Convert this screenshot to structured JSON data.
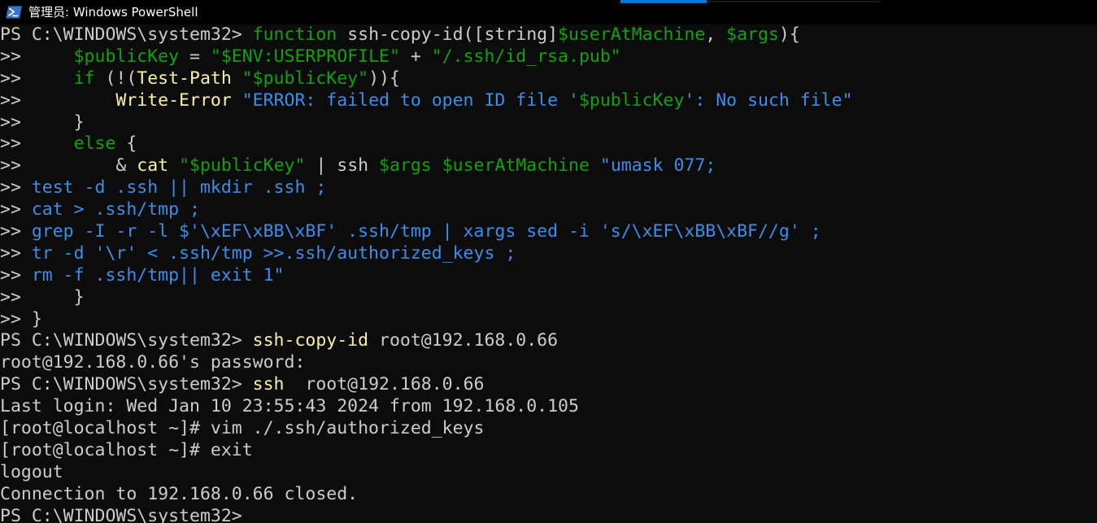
{
  "window": {
    "title": "管理员: Windows PowerShell",
    "icon": "powershell-icon",
    "accent_color": "#0078d7",
    "background_color": "#0c0c0c"
  },
  "palette": {
    "default_text": "#cccccc",
    "keyword_green": "#13a10e",
    "cmdlet_yellow": "#f9f1a5",
    "string_blue": "#3b8eea"
  },
  "terminal": {
    "prompt": "PS C:\\WINDOWS\\system32>",
    "continuation_prompt": ">>",
    "lines": [
      {
        "id": "line-01",
        "segments": [
          {
            "t": "PS C:\\WINDOWS\\system32> ",
            "c": "w"
          },
          {
            "t": "function",
            "c": "g"
          },
          {
            "t": " ssh-copy-id([string]",
            "c": "w"
          },
          {
            "t": "$userAtMachine",
            "c": "g"
          },
          {
            "t": ", ",
            "c": "w"
          },
          {
            "t": "$args",
            "c": "g"
          },
          {
            "t": "){",
            "c": "w"
          }
        ]
      },
      {
        "id": "line-02",
        "segments": [
          {
            "t": ">>     ",
            "c": "w"
          },
          {
            "t": "$publicKey",
            "c": "g"
          },
          {
            "t": " = ",
            "c": "w"
          },
          {
            "t": "\"$ENV:USERPROFILE\"",
            "c": "g"
          },
          {
            "t": " + ",
            "c": "w"
          },
          {
            "t": "\"/.ssh/id_rsa.pub\"",
            "c": "g"
          }
        ]
      },
      {
        "id": "line-03",
        "segments": [
          {
            "t": ">>     ",
            "c": "w"
          },
          {
            "t": "if",
            "c": "g"
          },
          {
            "t": " (!(",
            "c": "w"
          },
          {
            "t": "Test-Path",
            "c": "y"
          },
          {
            "t": " ",
            "c": "w"
          },
          {
            "t": "\"$publicKey\"",
            "c": "g"
          },
          {
            "t": ")){",
            "c": "w"
          }
        ]
      },
      {
        "id": "line-04",
        "segments": [
          {
            "t": ">>         ",
            "c": "w"
          },
          {
            "t": "Write-Error",
            "c": "y"
          },
          {
            "t": " ",
            "c": "w"
          },
          {
            "t": "\"ERROR: failed to open ID file '",
            "c": "c"
          },
          {
            "t": "$publicKey",
            "c": "g"
          },
          {
            "t": "': No such file\"",
            "c": "c"
          }
        ]
      },
      {
        "id": "line-05",
        "segments": [
          {
            "t": ">>     ",
            "c": "w"
          },
          {
            "t": "}",
            "c": "w"
          }
        ]
      },
      {
        "id": "line-06",
        "segments": [
          {
            "t": ">>     ",
            "c": "w"
          },
          {
            "t": "else",
            "c": "g"
          },
          {
            "t": " {",
            "c": "w"
          }
        ]
      },
      {
        "id": "line-07",
        "segments": [
          {
            "t": ">>         ",
            "c": "w"
          },
          {
            "t": "& ",
            "c": "w"
          },
          {
            "t": "cat",
            "c": "y"
          },
          {
            "t": " ",
            "c": "w"
          },
          {
            "t": "\"$publicKey\"",
            "c": "g"
          },
          {
            "t": " | ssh ",
            "c": "w"
          },
          {
            "t": "$args",
            "c": "g"
          },
          {
            "t": " ",
            "c": "w"
          },
          {
            "t": "$userAtMachine",
            "c": "g"
          },
          {
            "t": " ",
            "c": "w"
          },
          {
            "t": "\"umask 077;",
            "c": "c"
          }
        ]
      },
      {
        "id": "line-08",
        "segments": [
          {
            "t": ">> ",
            "c": "w"
          },
          {
            "t": "test -d .ssh || mkdir .ssh ;",
            "c": "c"
          }
        ]
      },
      {
        "id": "line-09",
        "segments": [
          {
            "t": ">> ",
            "c": "w"
          },
          {
            "t": "cat > .ssh/tmp ;",
            "c": "c"
          }
        ]
      },
      {
        "id": "line-10",
        "segments": [
          {
            "t": ">> ",
            "c": "w"
          },
          {
            "t": "grep -I -r -l $'\\xEF\\xBB\\xBF' .ssh/tmp | xargs sed -i 's/\\xEF\\xBB\\xBF//g' ;",
            "c": "c"
          }
        ]
      },
      {
        "id": "line-11",
        "segments": [
          {
            "t": ">> ",
            "c": "w"
          },
          {
            "t": "tr -d '\\r' < .ssh/tmp >>.ssh/authorized_keys ;",
            "c": "c"
          }
        ]
      },
      {
        "id": "line-12",
        "segments": [
          {
            "t": ">> ",
            "c": "w"
          },
          {
            "t": "rm -f .ssh/tmp|| exit 1\"",
            "c": "c"
          }
        ]
      },
      {
        "id": "line-13",
        "segments": [
          {
            "t": ">>     ",
            "c": "w"
          },
          {
            "t": "}",
            "c": "w"
          }
        ]
      },
      {
        "id": "line-14",
        "segments": [
          {
            "t": ">> ",
            "c": "w"
          },
          {
            "t": "}",
            "c": "w"
          }
        ]
      },
      {
        "id": "line-15",
        "segments": [
          {
            "t": "PS C:\\WINDOWS\\system32> ",
            "c": "w"
          },
          {
            "t": "ssh-copy-id",
            "c": "y"
          },
          {
            "t": " root@192.168.0.66",
            "c": "w"
          }
        ]
      },
      {
        "id": "line-16",
        "segments": [
          {
            "t": "root@192.168.0.66's password:",
            "c": "w"
          }
        ]
      },
      {
        "id": "line-17",
        "segments": [
          {
            "t": "PS C:\\WINDOWS\\system32> ",
            "c": "w"
          },
          {
            "t": "ssh",
            "c": "y"
          },
          {
            "t": "  root@192.168.0.66",
            "c": "w"
          }
        ]
      },
      {
        "id": "line-18",
        "segments": [
          {
            "t": "Last login: Wed Jan 10 23:55:43 2024 from 192.168.0.105",
            "c": "w"
          }
        ]
      },
      {
        "id": "line-19",
        "segments": [
          {
            "t": "[root@localhost ~]# vim ./.ssh/authorized_keys",
            "c": "w"
          }
        ]
      },
      {
        "id": "line-20",
        "segments": [
          {
            "t": "[root@localhost ~]# exit",
            "c": "w"
          }
        ]
      },
      {
        "id": "line-21",
        "segments": [
          {
            "t": "logout",
            "c": "w"
          }
        ]
      },
      {
        "id": "line-22",
        "segments": [
          {
            "t": "Connection to 192.168.0.66 closed.",
            "c": "w"
          }
        ]
      },
      {
        "id": "line-23",
        "segments": [
          {
            "t": "PS C:\\WINDOWS\\system32>",
            "c": "w"
          }
        ]
      }
    ]
  }
}
